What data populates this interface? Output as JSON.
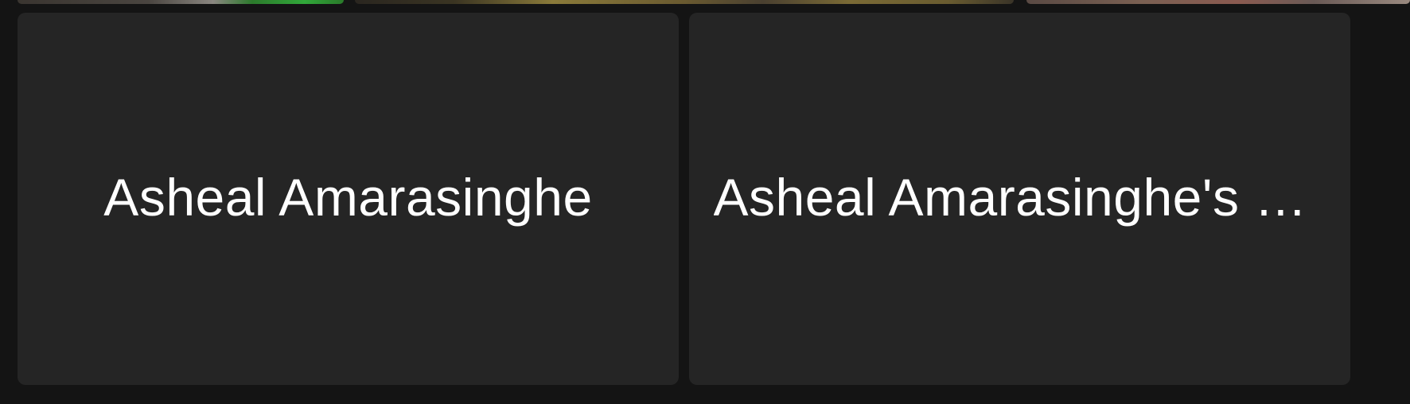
{
  "participants": [
    {
      "display_name": "Asheal Amarasinghe"
    },
    {
      "display_name": "Asheal Amarasinghe's G..."
    }
  ]
}
